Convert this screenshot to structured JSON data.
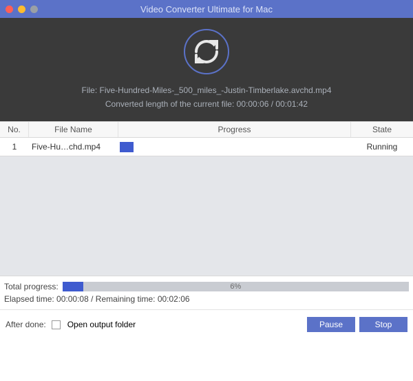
{
  "titlebar": {
    "title": "Video Converter Ultimate for Mac"
  },
  "header": {
    "file_prefix": "File: ",
    "file_name": "Five-Hundred-Miles-_500_miles_-Justin-Timberlake.avchd.mp4",
    "converted_prefix": "Converted length of the current file: ",
    "converted_current": "00:00:06",
    "converted_sep": " / ",
    "converted_total": "00:01:42"
  },
  "table": {
    "headers": {
      "no": "No.",
      "name": "File Name",
      "progress": "Progress",
      "state": "State"
    },
    "rows": [
      {
        "no": "1",
        "name": "Five-Hu…chd.mp4",
        "progress_pct": 6,
        "state": "Running"
      }
    ]
  },
  "total": {
    "label": "Total progress:",
    "pct_text": "6%",
    "pct": 6
  },
  "times": {
    "elapsed_label": "Elapsed time: ",
    "elapsed": "00:00:08",
    "sep": " / ",
    "remaining_label": "Remaining time: ",
    "remaining": "00:02:06"
  },
  "after": {
    "label": "After done:",
    "checkbox_label": "Open output folder"
  },
  "buttons": {
    "pause": "Pause",
    "stop": "Stop"
  }
}
